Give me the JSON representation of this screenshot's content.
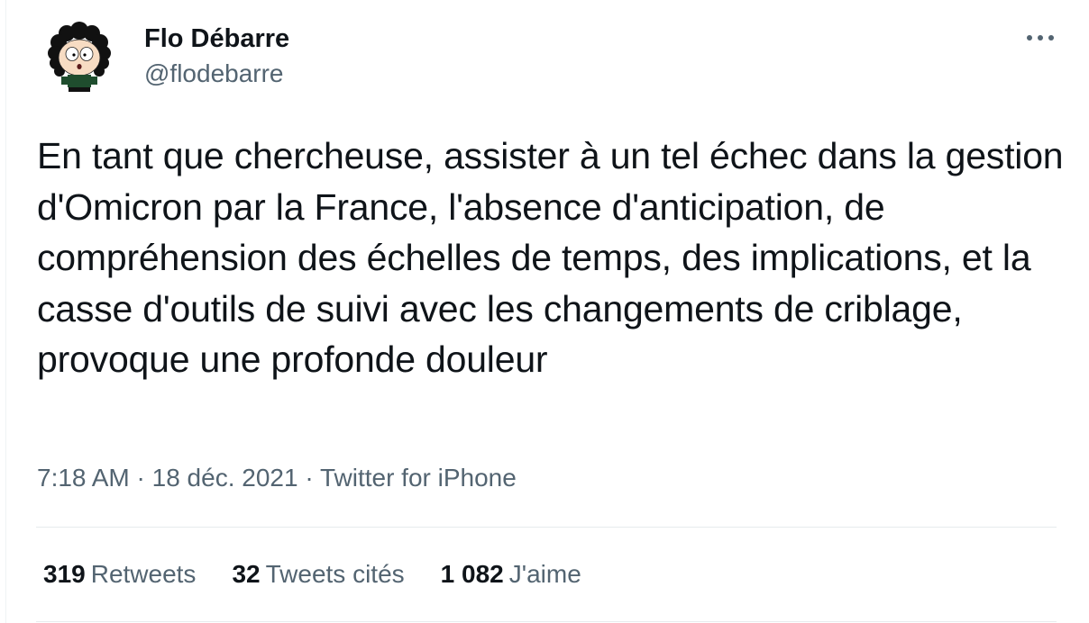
{
  "author": {
    "name": "Flo Débarre",
    "handle": "@flodebarre"
  },
  "tweet": {
    "text": "En tant que chercheuse, assister à un tel échec dans la gestion d'Omicron par la France, l'absence d'anticipation, de compréhension des échelles de temps, des implications, et la casse d'outils de suivi avec les changements de criblage, provoque une profonde douleur",
    "time": "7:18 AM",
    "date": "18 déc. 2021",
    "separator": "·",
    "source": "Twitter for iPhone"
  },
  "stats": {
    "retweets": {
      "count": "319",
      "label": "Retweets"
    },
    "quotes": {
      "count": "32",
      "label": "Tweets cités"
    },
    "likes": {
      "count": "1 082",
      "label": "J'aime"
    }
  },
  "icons": {
    "avatar": "south-park-style-cartoon-avatar",
    "more": "more-horizontal-icon"
  },
  "colors": {
    "text_primary": "#0f1419",
    "text_secondary": "#536471",
    "divider": "#e7ebed"
  }
}
